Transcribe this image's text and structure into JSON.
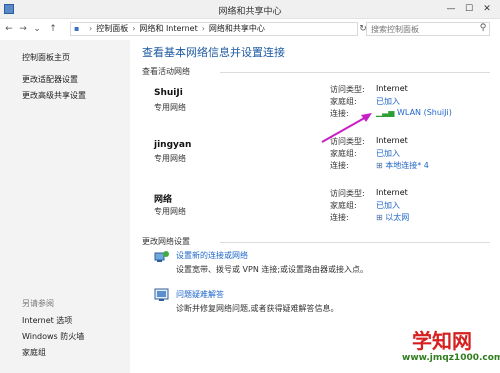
{
  "window": {
    "title": "网络和共享中心",
    "controls": [
      "—",
      "☐",
      "✕"
    ]
  },
  "address_bar": {
    "crumbs": [
      "控制面板",
      "网络和 Internet",
      "网络和共享中心"
    ],
    "search_placeholder": "搜索控制面板"
  },
  "sidebar": {
    "items": [
      "控制面板主页",
      "更改适配器设置",
      "更改高级共享设置"
    ],
    "see_also_title": "另请参阅",
    "see_also": [
      "Internet 选项",
      "Windows 防火墙",
      "家庭组"
    ]
  },
  "main": {
    "heading": "查看基本网络信息并设置连接",
    "active_networks_title": "查看活动网络",
    "labels": {
      "access_type": "访问类型:",
      "homegroup": "家庭组:",
      "connection": "连接:"
    },
    "networks": [
      {
        "name": "ShuiJi",
        "type": "专用网络",
        "access": "Internet",
        "homegroup": "已加入",
        "connection": "WLAN (ShuiJi)"
      },
      {
        "name": "jingyan",
        "type": "专用网络",
        "access": "Internet",
        "homegroup": "已加入",
        "connection": "本地连接* 4"
      },
      {
        "name": "网络",
        "type": "专用网络",
        "access": "Internet",
        "homegroup": "已加入",
        "connection": "以太网"
      }
    ],
    "change_settings_title": "更改网络设置",
    "tasks": [
      {
        "link": "设置新的连接或网络",
        "desc": "设置宽带、拨号或 VPN 连接;或设置路由器或接入点。"
      },
      {
        "link": "问题疑难解答",
        "desc": "诊断并修复网络问题,或者获得疑难解答信息。"
      }
    ]
  },
  "watermark": {
    "main": "学知网",
    "url": "www.jmqz1000.com"
  },
  "colors": {
    "link": "#1e66c8",
    "heading": "#1e5aa0",
    "arrow": "#c81ec8",
    "watermark_red": "#d62020",
    "watermark_green": "#2f7d1e"
  }
}
